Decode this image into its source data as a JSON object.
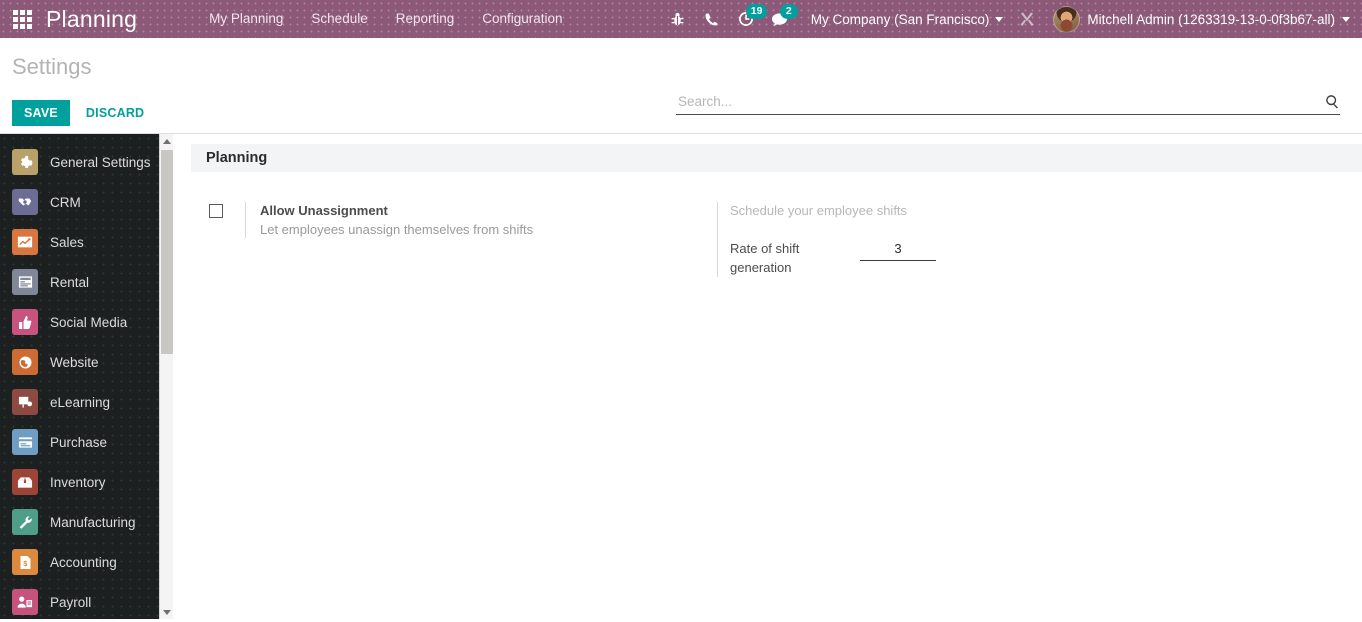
{
  "navbar": {
    "apps_icon": "apps-grid-icon",
    "brand": "Planning",
    "menu": [
      {
        "label": "My Planning"
      },
      {
        "label": "Schedule"
      },
      {
        "label": "Reporting"
      },
      {
        "label": "Configuration"
      }
    ],
    "icons": [
      {
        "name": "bug-icon",
        "glyph": "☣"
      },
      {
        "name": "phone-icon",
        "glyph": "✆"
      }
    ],
    "activity": {
      "name": "clock-activity-icon",
      "glyph": "◴",
      "badge": "19"
    },
    "messages": {
      "name": "chat-bubble-icon",
      "glyph": "ὊC",
      "badge": "2"
    },
    "company": "My Company (San Francisco)",
    "tools_icon": "tools-wrench-icon",
    "user_name": "Mitchell Admin (1263319-13-0-0f3b67-all)",
    "avatar": "user-avatar"
  },
  "control_panel": {
    "title": "Settings",
    "save_label": "SAVE",
    "discard_label": "DISCARD",
    "search_placeholder": "Search...",
    "search_value": "",
    "search_icon": "search-icon"
  },
  "sidebar": {
    "items": [
      {
        "label": "General Settings",
        "icon": "gear-icon",
        "glyph": "⚙",
        "color": "#b8a269"
      },
      {
        "label": "CRM",
        "icon": "handshake-icon",
        "glyph": "☺",
        "color": "#6b6d94"
      },
      {
        "label": "Sales",
        "icon": "chart-up-icon",
        "glyph": "↗",
        "color": "#d9763f"
      },
      {
        "label": "Rental",
        "icon": "document-icon",
        "glyph": "▤",
        "color": "#7f8799"
      },
      {
        "label": "Social Media",
        "icon": "thumbs-up-icon",
        "glyph": "☝",
        "color": "#c9537f"
      },
      {
        "label": "Website",
        "icon": "globe-icon",
        "glyph": "◕",
        "color": "#cc6b33"
      },
      {
        "label": "eLearning",
        "icon": "presentation-icon",
        "glyph": "▣",
        "color": "#8d4a42"
      },
      {
        "label": "Purchase",
        "icon": "card-icon",
        "glyph": "▦",
        "color": "#6f9dc4"
      },
      {
        "label": "Inventory",
        "icon": "box-icon",
        "glyph": "✉",
        "color": "#9c4536"
      },
      {
        "label": "Manufacturing",
        "icon": "wrench-icon",
        "glyph": "⚒",
        "color": "#4f9e87"
      },
      {
        "label": "Accounting",
        "icon": "invoice-icon",
        "glyph": "$",
        "color": "#db8a3e"
      },
      {
        "label": "Payroll",
        "icon": "employee-icon",
        "glyph": "☻",
        "color": "#c5537c"
      }
    ],
    "scroll_up_icon": "scroll-up-arrow-icon",
    "scroll_down_icon": "scroll-down-arrow-icon"
  },
  "settings": {
    "section_title": "Planning",
    "allow_unassignment": {
      "checked": false,
      "title": "Allow Unassignment",
      "description": "Let employees unassign themselves from shifts"
    },
    "schedule_block": {
      "caption": "Schedule your employee shifts",
      "field_label": "Rate of shift generation",
      "field_value": "3"
    }
  },
  "colors": {
    "navbar": "#8a5a78",
    "accent_teal": "#00a09d",
    "sidebar_bg": "#1d2021",
    "section_band": "#f3f4f6"
  }
}
